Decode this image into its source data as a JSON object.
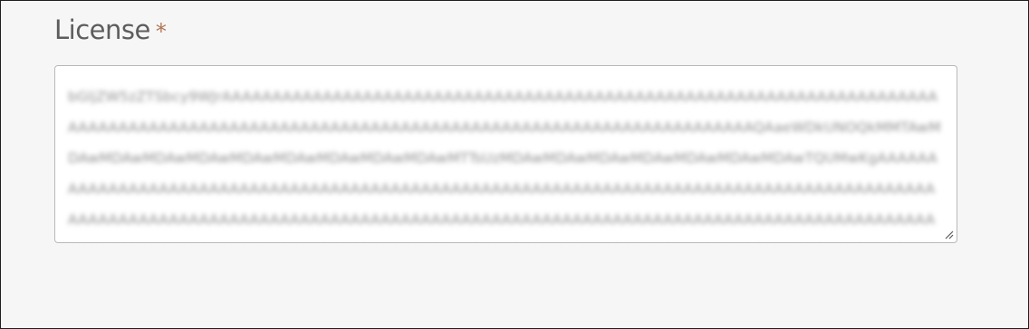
{
  "license_field": {
    "label": "License",
    "required_marker": "*",
    "value": "bGljZW5zZTSbcy9WJrAAAAAAAAAAAAAAAAAAAAAAAAAAAAAAAAAAAAAAAAAAAAAAAAAAAAAAAAAAAAAAAAAAAAAAAAAAAAAAAAAAAAAAAAAAAAAAAAAAAAAAAAAAAAAAAAAAAAAAAAAAAAAAAAAAAAAAAAAAAQAaeWDkUNOQkMMTAwMDAwMDAwMDAwMDAwMDAwMDAwMDAwMDAwMDAwMTTsUzMDAwMDAwMDAwMDAwMDAwMDAwMDAwTQUMwKgAAAAAAAAAAAAAAAAAAAAAAAAAAAAAAAAAAAAAAAAAAAAAAAAAAAAAAAAAAAAAAAAAAAAAAAAAAAAAAAAAAAAAAAAAAAAAAAAAAAAAAAAAAAAAAAAAAAAAAAAAAAAAAAAAAAAAAAAAAAAAAAAAAAAAAAAAAAAAAAAAAAAAAAAAAAAAAAAAAAAAAAAAAAAAAAAAAAAAAAAAAAAAAAAAAAAAAAAAAAAAAAAAAAAAAAAAAAAAAAAAAAAAAAAAAAAAAAAAAAAAAAAAAAAAAAAAAAAAAAAAAAAAAAAAAAAAAA"
  }
}
